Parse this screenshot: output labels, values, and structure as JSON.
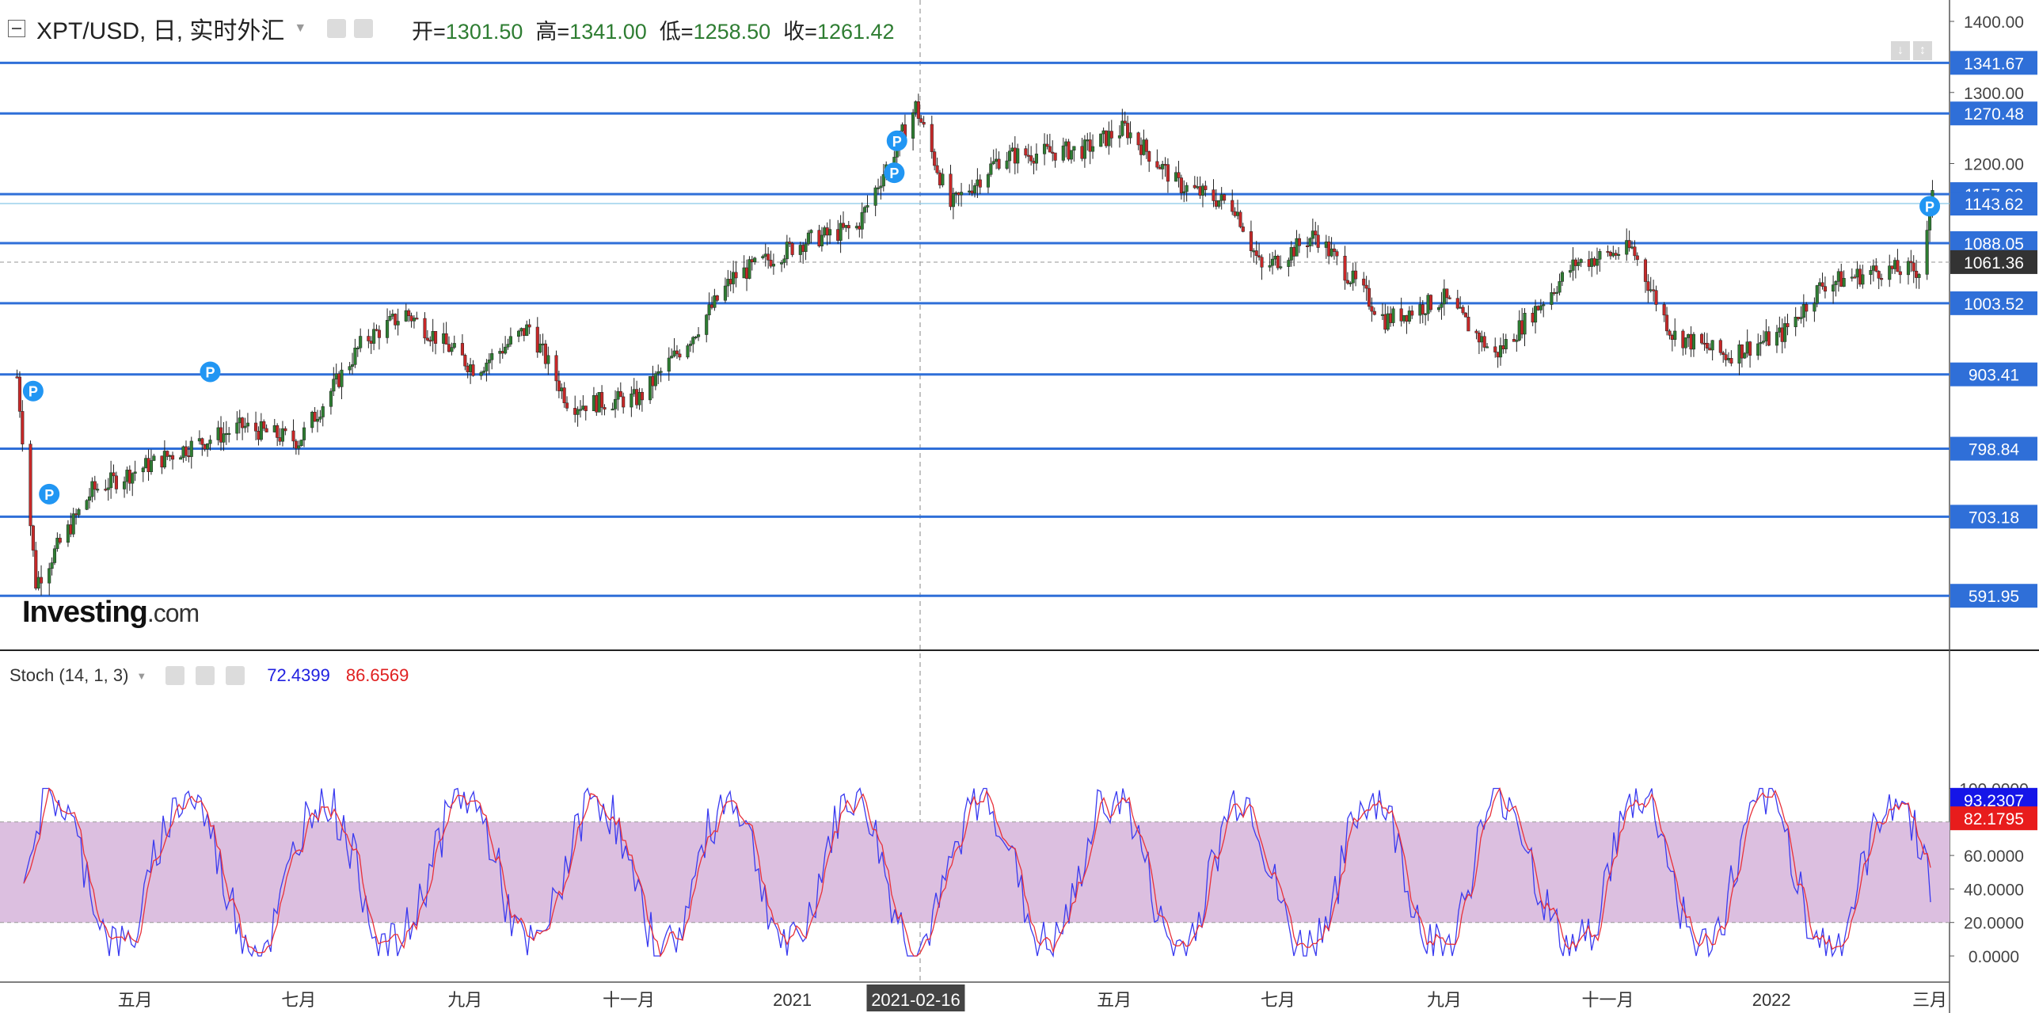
{
  "header": {
    "symbol_title": "XPT/USD, 日, 实时外汇",
    "ohlc": [
      {
        "label": "开=",
        "value": "1301.50"
      },
      {
        "label": "高=",
        "value": "1341.00"
      },
      {
        "label": "低=",
        "value": "1258.50"
      },
      {
        "label": "收=",
        "value": "1261.42"
      }
    ]
  },
  "watermark": {
    "brand": "Investing",
    "suffix": ".com"
  },
  "colors": {
    "up_candle": "#2e7d32",
    "down_candle": "#c62828",
    "hline": "#2f6fd8",
    "stoch_k": "#3a3af0",
    "stoch_d": "#e8313a",
    "stoch_band": "#dcbfe0",
    "current_price_tag": "#333333",
    "marker": "#2196f3"
  },
  "stoch": {
    "title": "Stoch (14, 1, 3)",
    "k_value": "72.4399",
    "d_value": "86.6569",
    "k_tag": "93.2307",
    "d_tag": "82.1795"
  },
  "chart_data": [
    {
      "type": "candlestick",
      "title": "XPT/USD, 日, 实时外汇",
      "x_axis": {
        "ticks": [
          "五月",
          "七月",
          "九月",
          "十一月",
          "2021",
          "2021-02-16",
          "五月",
          "七月",
          "九月",
          "十一月",
          "2022",
          "三月"
        ],
        "highlighted_tick": "2021-02-16"
      },
      "y_axis": {
        "ticks": [
          "1400.00",
          "1300.00",
          "1200.00"
        ],
        "range": [
          520,
          1420
        ]
      },
      "horizontal_levels": [
        "1341.67",
        "1270.48",
        "1157.02",
        "1088.05",
        "1003.52",
        "903.41",
        "798.84",
        "703.18",
        "591.95"
      ],
      "price_tags": [
        "1143.62",
        "1061.36"
      ],
      "markers": [
        {
          "label": "P",
          "x": "2020-03-24",
          "y": 880
        },
        {
          "label": "P",
          "x": "2020-03-30",
          "y": 735
        },
        {
          "label": "P",
          "x": "2020-05-29",
          "y": 907
        },
        {
          "label": "P",
          "x": "2021-02-08",
          "y": 1187
        },
        {
          "label": "P",
          "x": "2021-02-09",
          "y": 1232
        },
        {
          "label": "P",
          "x": "2022-03-01",
          "y": 1140
        }
      ],
      "key_points": [
        {
          "date": "2020-03-18",
          "close": 900
        },
        {
          "date": "2020-03-25",
          "close": 610
        },
        {
          "date": "2020-04-15",
          "close": 740
        },
        {
          "date": "2020-05-20",
          "close": 800
        },
        {
          "date": "2020-06-10",
          "close": 830
        },
        {
          "date": "2020-07-01",
          "close": 810
        },
        {
          "date": "2020-07-25",
          "close": 950
        },
        {
          "date": "2020-08-10",
          "close": 990
        },
        {
          "date": "2020-09-05",
          "close": 910
        },
        {
          "date": "2020-09-25",
          "close": 970
        },
        {
          "date": "2020-10-10",
          "close": 860
        },
        {
          "date": "2020-11-05",
          "close": 870
        },
        {
          "date": "2020-11-25",
          "close": 960
        },
        {
          "date": "2020-12-10",
          "close": 1040
        },
        {
          "date": "2021-01-05",
          "close": 1090
        },
        {
          "date": "2021-01-25",
          "close": 1110
        },
        {
          "date": "2021-02-16",
          "close": 1280
        },
        {
          "date": "2021-03-01",
          "close": 1140
        },
        {
          "date": "2021-03-20",
          "close": 1210
        },
        {
          "date": "2021-04-20",
          "close": 1220
        },
        {
          "date": "2021-05-05",
          "close": 1250
        },
        {
          "date": "2021-05-25",
          "close": 1170
        },
        {
          "date": "2021-06-15",
          "close": 1140
        },
        {
          "date": "2021-06-25",
          "close": 1050
        },
        {
          "date": "2021-07-15",
          "close": 1100
        },
        {
          "date": "2021-08-10",
          "close": 980
        },
        {
          "date": "2021-09-01",
          "close": 1010
        },
        {
          "date": "2021-09-20",
          "close": 930
        },
        {
          "date": "2021-10-20",
          "close": 1060
        },
        {
          "date": "2021-11-10",
          "close": 1080
        },
        {
          "date": "2021-11-25",
          "close": 960
        },
        {
          "date": "2021-12-15",
          "close": 930
        },
        {
          "date": "2022-01-05",
          "close": 960
        },
        {
          "date": "2022-01-20",
          "close": 1030
        },
        {
          "date": "2022-02-10",
          "close": 1050
        },
        {
          "date": "2022-02-25",
          "close": 1050
        },
        {
          "date": "2022-03-02",
          "close": 1150
        }
      ]
    },
    {
      "type": "line",
      "title": "Stoch (14, 1, 3)",
      "y_axis": {
        "ticks": [
          "100.0000",
          "60.0000",
          "40.0000",
          "20.0000",
          "0.0000"
        ],
        "range": [
          -8,
          106
        ]
      },
      "band": [
        20,
        80
      ],
      "series": [
        {
          "name": "%K",
          "color": "#3a3af0",
          "last": 72.4399
        },
        {
          "name": "%D",
          "color": "#e8313a",
          "last": 86.6569
        }
      ]
    }
  ]
}
